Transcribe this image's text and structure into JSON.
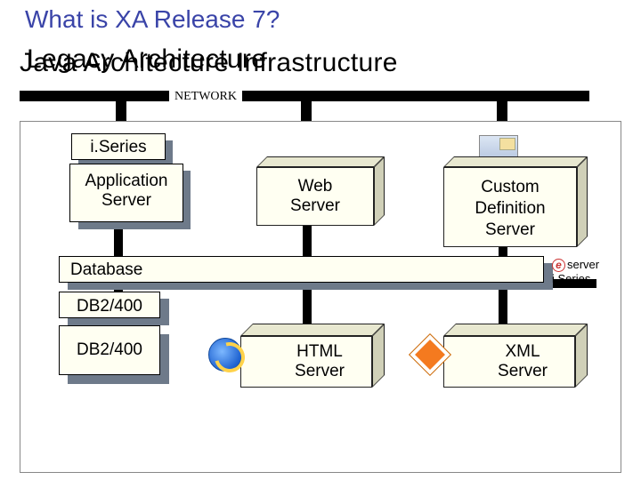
{
  "title": "What is XA Release 7?",
  "subtitle_back": "Legacy Architecture",
  "subtitle_front": "Java Architecture Infrastructure",
  "network_label": "NETWORK",
  "top_row": {
    "iseries": "i.Series",
    "app_server": "Application\nServer",
    "web_server": "Web\nServer",
    "custom_def_server": "Custom\nDefinition\nServer"
  },
  "mid": {
    "database": "Database",
    "eserver_line1": "server",
    "eserver_line2": "i.Series"
  },
  "bottom": {
    "db2a": "DB2/400",
    "db2b": "DB2/400",
    "html_server": "HTML\nServer",
    "xml_server": "XML\nServer"
  }
}
